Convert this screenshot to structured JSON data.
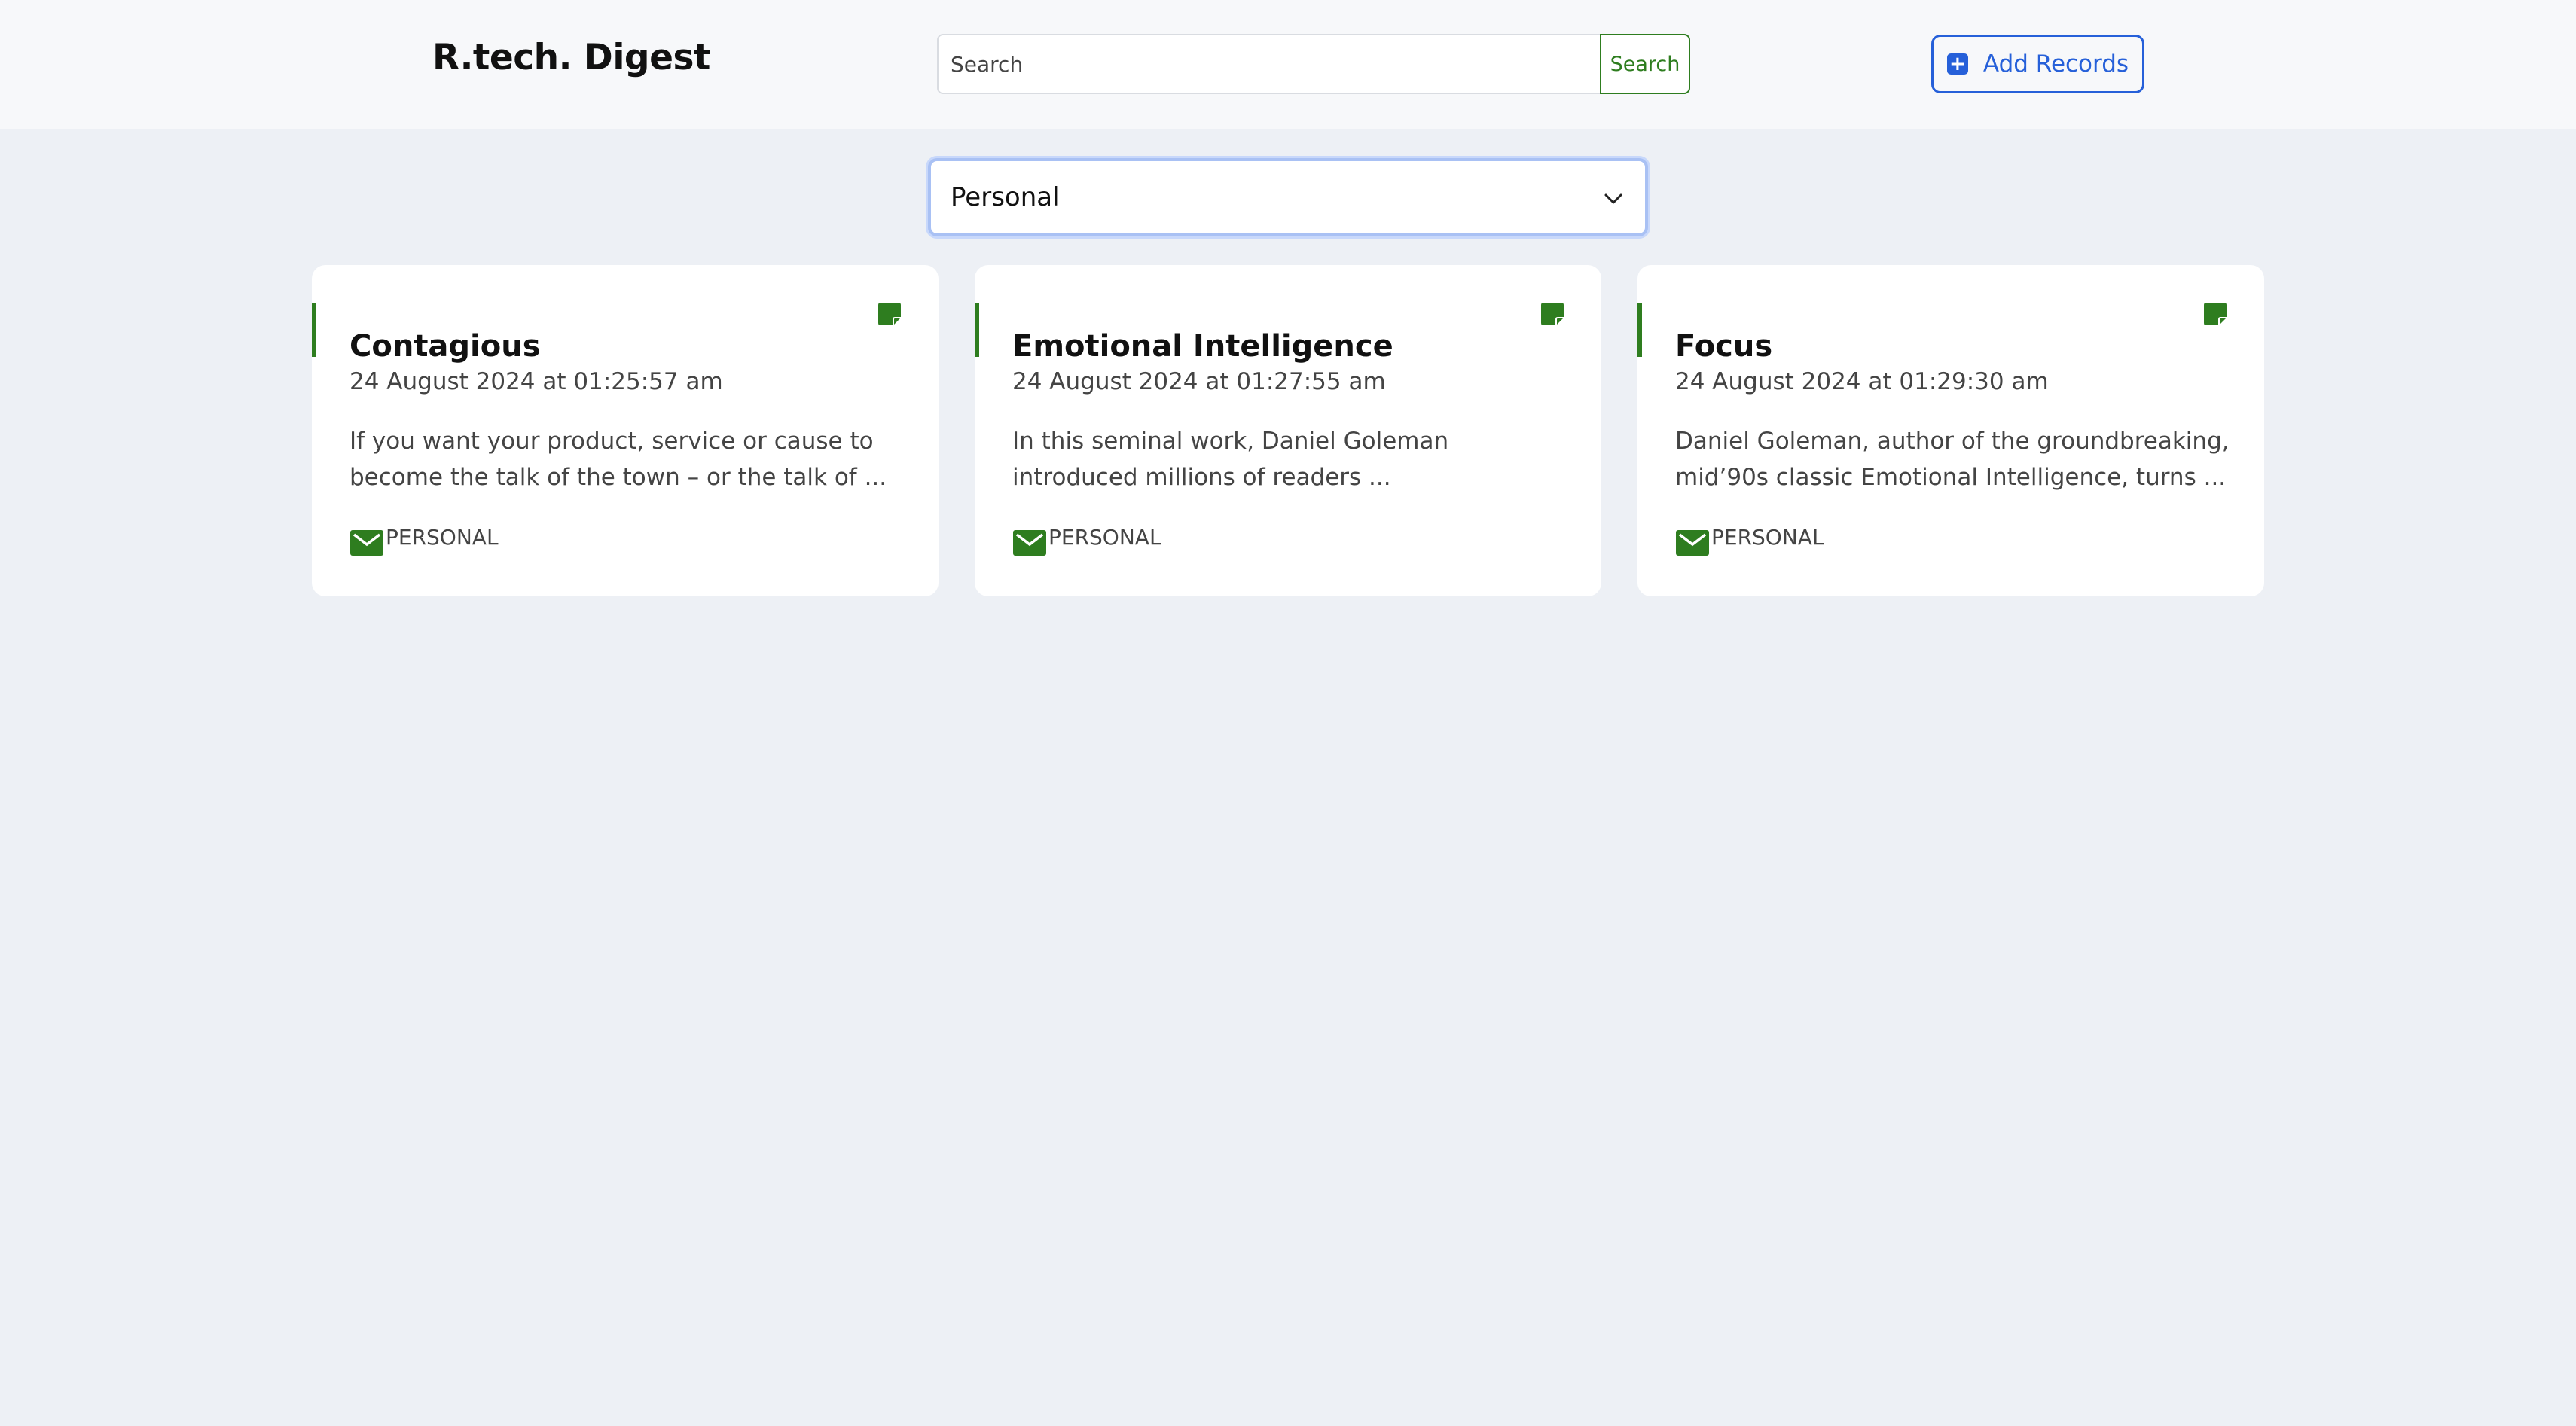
{
  "header": {
    "brand": "R.tech. Digest",
    "search_placeholder": "Search",
    "search_button": "Search",
    "add_button": "Add Records"
  },
  "filter": {
    "selected": "Personal"
  },
  "cards": [
    {
      "title": "Contagious",
      "date": "24 August 2024 at 01:25:57 am",
      "excerpt": "If you want your product, service or cause to become the talk of the town – or the talk of ...",
      "tag": "PERSONAL"
    },
    {
      "title": "Emotional Intelligence",
      "date": "24 August 2024 at 01:27:55 am",
      "excerpt": "In this seminal work, Daniel Goleman introduced millions of readers ...",
      "tag": "PERSONAL"
    },
    {
      "title": "Focus",
      "date": "24 August 2024 at 01:29:30 am",
      "excerpt": "Daniel Goleman, author of the groundbreaking, mid’90s classic Emotional Intelligence, turns ...",
      "tag": "PERSONAL"
    }
  ],
  "colors": {
    "accent_green": "#2e7d1f",
    "primary_blue": "#2660d9",
    "page_background": "#edf0f5"
  }
}
